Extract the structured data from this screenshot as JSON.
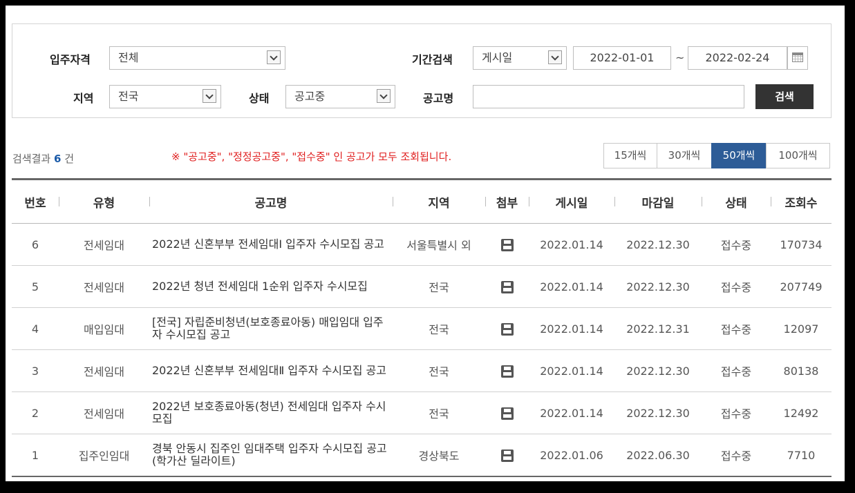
{
  "filters": {
    "eligibility_label": "입주자격",
    "eligibility_value": "전체",
    "period_label": "기간검색",
    "period_type_value": "게시일",
    "date_from": "2022-01-01",
    "date_separator": "~",
    "date_to": "2022-02-24",
    "region_label": "지역",
    "region_value": "전국",
    "status_label": "상태",
    "status_value": "공고중",
    "title_label": "공고명",
    "title_value": "",
    "search_button": "검색"
  },
  "results": {
    "count_prefix": "검색결과",
    "count": "6",
    "count_suffix": "건",
    "notice": "※ \"공고중\", \"정정공고중\", \"접수중\" 인 공고가 모두 조회됩니다."
  },
  "per_page": {
    "options": [
      "15개씩",
      "30개씩",
      "50개씩",
      "100개씩"
    ],
    "selected": "50개씩"
  },
  "table": {
    "headers": [
      "번호",
      "유형",
      "공고명",
      "지역",
      "첨부",
      "게시일",
      "마감일",
      "상태",
      "조회수"
    ],
    "rows": [
      {
        "no": "6",
        "type": "전세임대",
        "title": "2022년 신혼부부 전세임대Ⅰ 입주자 수시모집 공고",
        "region": "서울특별시 외",
        "posted": "2022.01.14",
        "deadline": "2022.12.30",
        "status": "접수중",
        "views": "170734"
      },
      {
        "no": "5",
        "type": "전세임대",
        "title": "2022년 청년 전세임대 1순위 입주자 수시모집",
        "region": "전국",
        "posted": "2022.01.14",
        "deadline": "2022.12.30",
        "status": "접수중",
        "views": "207749"
      },
      {
        "no": "4",
        "type": "매입임대",
        "title": "[전국] 자립준비청년(보호종료아동) 매입임대 입주자 수시모집 공고",
        "region": "전국",
        "posted": "2022.01.14",
        "deadline": "2022.12.31",
        "status": "접수중",
        "views": "12097"
      },
      {
        "no": "3",
        "type": "전세임대",
        "title": "2022년 신혼부부 전세임대Ⅱ 입주자 수시모집 공고",
        "region": "전국",
        "posted": "2022.01.14",
        "deadline": "2022.12.30",
        "status": "접수중",
        "views": "80138"
      },
      {
        "no": "2",
        "type": "전세임대",
        "title": "2022년 보호종료아동(청년) 전세임대 입주자 수시모집",
        "region": "전국",
        "posted": "2022.01.14",
        "deadline": "2022.12.30",
        "status": "접수중",
        "views": "12492"
      },
      {
        "no": "1",
        "type": "집주인임대",
        "title": "경북 안동시 집주인 임대주택 입주자 수시모집 공고(학가산 딜라이트)",
        "region": "경상북도",
        "posted": "2022.01.06",
        "deadline": "2022.06.30",
        "status": "접수중",
        "views": "7710"
      }
    ]
  }
}
